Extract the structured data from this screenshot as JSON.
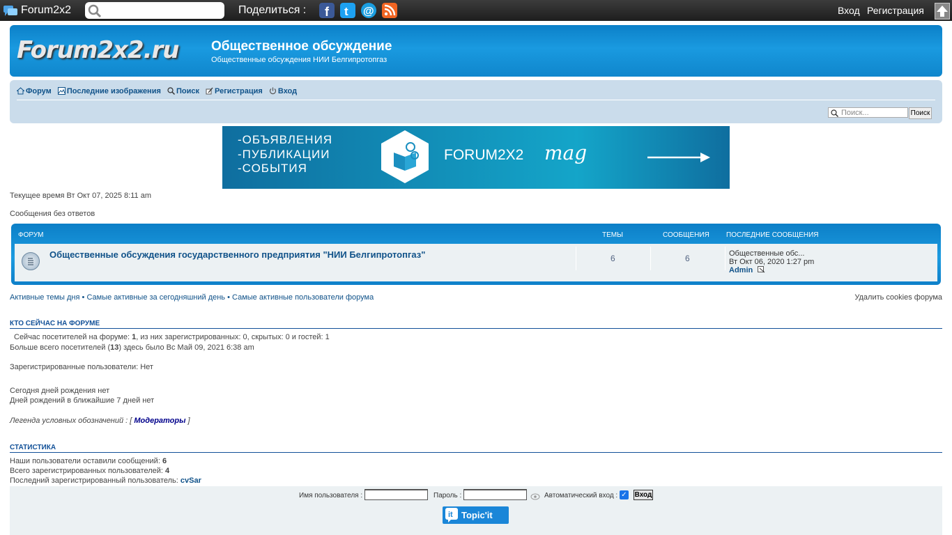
{
  "topbar": {
    "site_name": "Forum2x2",
    "share_label": "Поделиться :",
    "login": "Вход",
    "register": "Регистрация",
    "social": [
      "facebook-icon",
      "twitter-icon",
      "email-icon",
      "rss-icon"
    ],
    "colors": {
      "facebook": "#3b5998",
      "twitter": "#1da1f2",
      "email": "#1a9ee0",
      "rss": "#f26522"
    }
  },
  "header": {
    "brand": "Forum2x2.ru",
    "title": "Общественное обсуждение",
    "description": "Общественные обсуждения НИИ Белгипротопгаз"
  },
  "nav": {
    "items": [
      {
        "label": "Форум",
        "icon": "home-icon"
      },
      {
        "label": "Последние изображения",
        "icon": "image-icon"
      },
      {
        "label": "Поиск",
        "icon": "search-icon"
      },
      {
        "label": "Регистрация",
        "icon": "register-icon"
      },
      {
        "label": "Вход",
        "icon": "power-icon"
      }
    ],
    "search_placeholder": "Поиск...",
    "search_button": "Поиск"
  },
  "banner": {
    "line1": "-ОБЪЯВЛЕНИЯ",
    "line2": "-ПУБЛИКАЦИИ",
    "line3": "-СОБЫТИЯ",
    "name": "FORUM2X2",
    "suffix": "mag"
  },
  "page": {
    "current_time": "Текущее время Вт Окт 07, 2025 8:11 am",
    "unanswered": "Сообщения без ответов"
  },
  "forum_table": {
    "headers": {
      "forum": "ФОРУМ",
      "topics": "ТЕМЫ",
      "posts": "СООБЩЕНИЯ",
      "last": "ПОСЛЕДНИЕ СООБЩЕНИЯ"
    },
    "rows": [
      {
        "name": "Общественные обсуждения государственного предприятия \"НИИ Белгипротопгаз\"",
        "topics": "6",
        "posts": "6",
        "last_title": "Общественные обс...",
        "last_date": "Вт Окт 06, 2020 1:27 pm",
        "last_author": "Admin"
      }
    ]
  },
  "links": {
    "active_topics": "Активные темы дня",
    "bullet": "•",
    "most_active_today": "Самые активные за сегодняшний день",
    "most_active_users": "Самые активные пользователи форума",
    "delete_cookies": "Удалить cookies форума"
  },
  "who_online": {
    "title": "КТО СЕЙЧАС НА ФОРУМЕ",
    "line1_a": "Сейчас посетителей на форуме: ",
    "line1_b": "1",
    "line1_c": ", из них зарегистрированных: 0, скрытых: 0 и гостей: 1",
    "line2_a": "Больше всего посетителей (",
    "line2_b": "13",
    "line2_c": ") здесь было Вс Май 09, 2021 6:38 am",
    "registered": "Зарегистрированные пользователи: Нет",
    "birthday_today": "Сегодня дней рождения нет",
    "birthday_week": "Дней рождений в ближайшие 7 дней нет",
    "legend_a": "Легенда условных обозначений : [ ",
    "legend_mod": "Модераторы",
    "legend_b": " ]"
  },
  "stats": {
    "title": "СТАТИСТИКА",
    "posts_label": "Наши пользователи оставили сообщений: ",
    "posts_value": "6",
    "users_label": "Всего зарегистрированных пользователей: ",
    "users_value": "4",
    "last_user_label": "Последний зарегистрированный пользователь: ",
    "last_user_value": "cvSar"
  },
  "login_bar": {
    "username_label": "Имя пользователя :",
    "password_label": "Пароль :",
    "autologin_label": "Автоматический вход :",
    "login_button": "Вход",
    "topicit": "Topic'it"
  }
}
